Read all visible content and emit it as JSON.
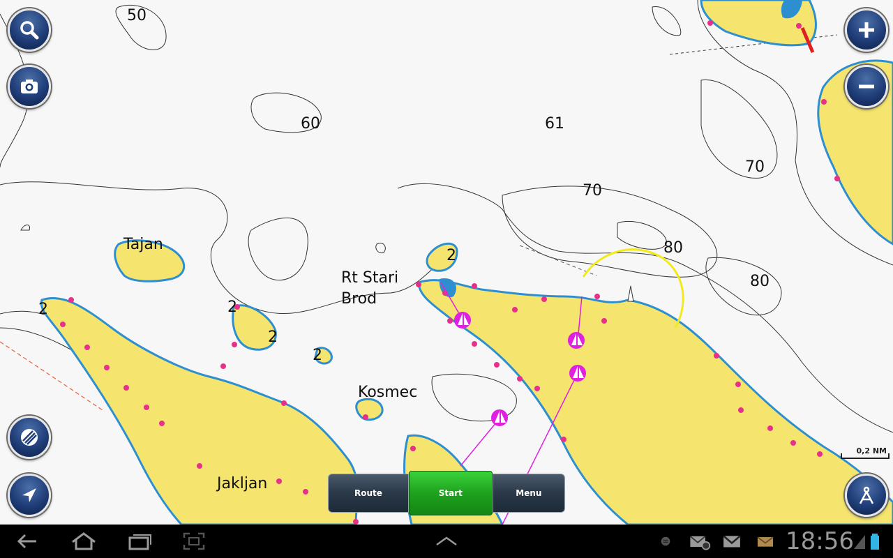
{
  "map": {
    "depth_labels": [
      {
        "id": "d50",
        "text": "50"
      },
      {
        "id": "d60",
        "text": "60"
      },
      {
        "id": "d61",
        "text": "61"
      },
      {
        "id": "d70a",
        "text": "70"
      },
      {
        "id": "d70b",
        "text": "70"
      },
      {
        "id": "d80a",
        "text": "80"
      },
      {
        "id": "d80b",
        "text": "80"
      },
      {
        "id": "d2a",
        "text": "2"
      },
      {
        "id": "d2b",
        "text": "2"
      },
      {
        "id": "d2c",
        "text": "2"
      },
      {
        "id": "d2d",
        "text": "2"
      },
      {
        "id": "d2e",
        "text": "2"
      }
    ],
    "place_labels": {
      "tajan": "Tajan",
      "rt_stari": "Rt Stari",
      "brod": "Brod",
      "kosmec": "Kosmec",
      "jakljan": "Jakljan"
    },
    "scale": "0,2 NM",
    "colors": {
      "land": "#f5e46e",
      "shallow": "#2e8fd0",
      "water": "#f7f7f7",
      "route": "#e020e0",
      "marker": "#e8308a",
      "arc": "#f2ea1a"
    }
  },
  "controls": {
    "search": "search-icon",
    "camera": "camera-icon",
    "zoom_in": "plus-icon",
    "zoom_out": "minus-icon",
    "layers": "layers-icon",
    "navigate": "navigation-arrow-icon",
    "autopilot": "compass-icon"
  },
  "toolbar": {
    "route": "Route",
    "start": "Start",
    "menu": "Menu"
  },
  "status": {
    "time": "18:56"
  }
}
